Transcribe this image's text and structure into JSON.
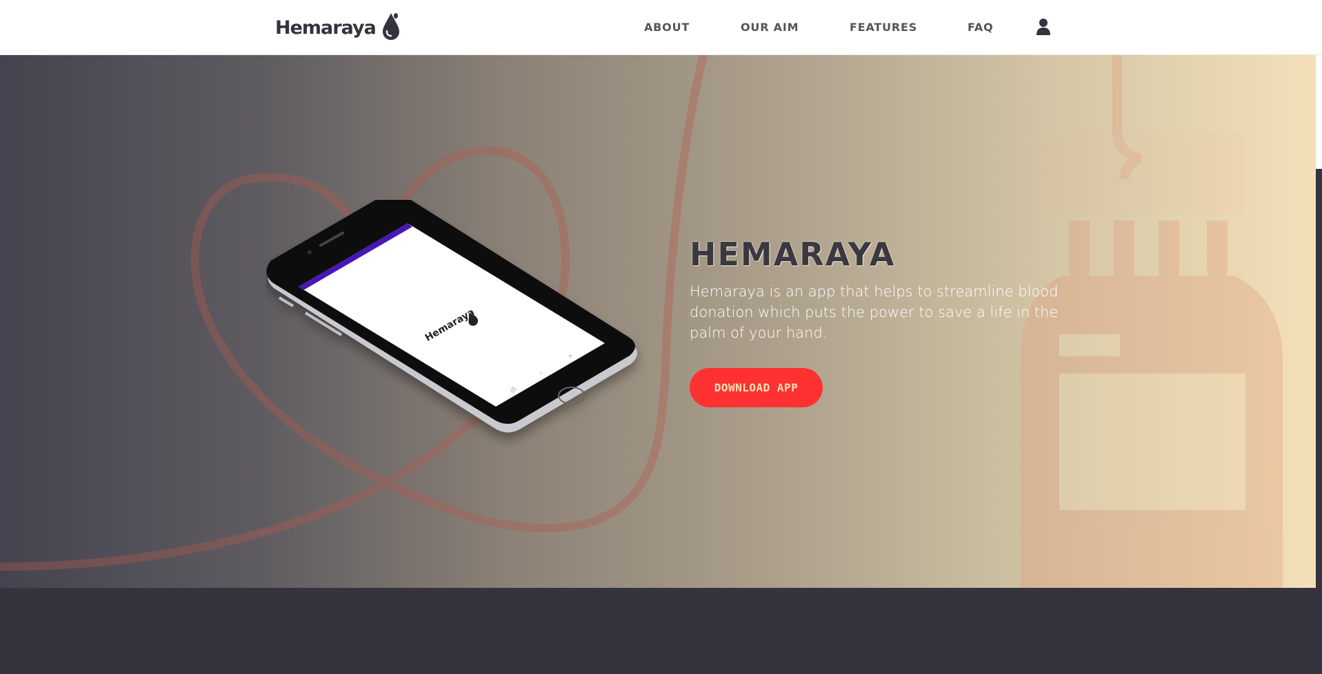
{
  "brand": {
    "name": "Hemaraya",
    "color": "#34333e"
  },
  "nav": {
    "items": [
      {
        "label": "ABOUT"
      },
      {
        "label": "OUR AIM"
      },
      {
        "label": "FEATURES"
      },
      {
        "label": "FAQ"
      }
    ],
    "user_icon": "user-icon"
  },
  "hero": {
    "title": "HEMARAYA",
    "description": "Hemaraya is an app that helps to streamline blood donation which puts the power to save a life in the palm of your hand.",
    "cta_label": "DOWNLOAD APP",
    "cta_color": "#ff3131",
    "phone_screen_text": "Hemaraya",
    "phone_status_bar_color": "#4a17b8"
  },
  "colors": {
    "navbar_bg": "#ffffff",
    "page_bg": "#34333e",
    "gradient_start": "#44434f",
    "gradient_end": "#f4e0b8",
    "tube_color": "#b45a50"
  }
}
